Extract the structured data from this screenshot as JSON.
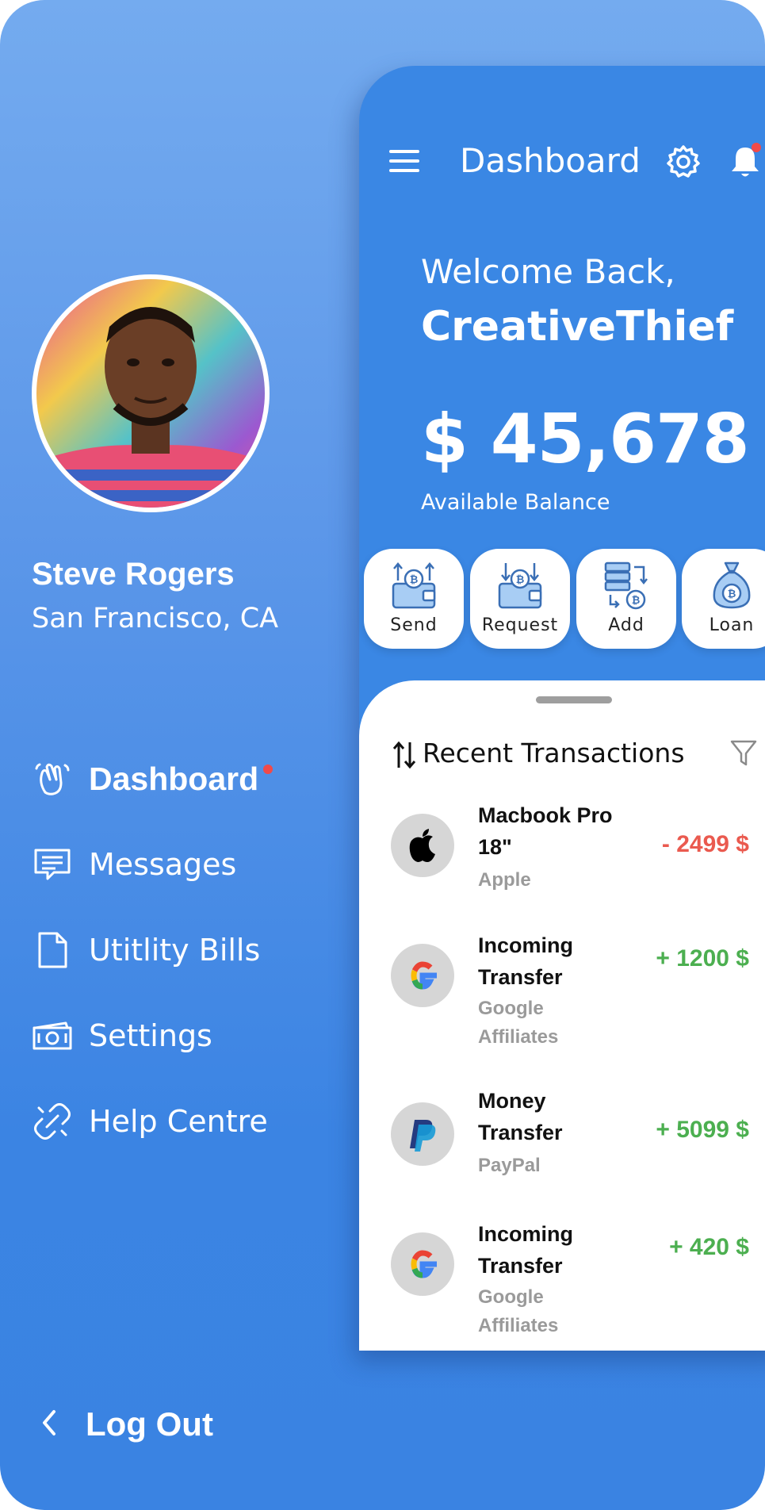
{
  "profile": {
    "name": "Steve Rogers",
    "location": "San Francisco, CA"
  },
  "menu": [
    {
      "label": "Dashboard",
      "icon": "hand-wave-icon",
      "active": true
    },
    {
      "label": "Messages",
      "icon": "message-icon",
      "active": false
    },
    {
      "label": "Utitlity Bills",
      "icon": "document-icon",
      "active": false
    },
    {
      "label": "Settings",
      "icon": "banknote-icon",
      "active": false
    },
    {
      "label": "Help Centre",
      "icon": "link-icon",
      "active": false
    }
  ],
  "logout": {
    "label": "Log Out"
  },
  "header": {
    "title": "Dashboard"
  },
  "welcome": {
    "greeting": "Welcome Back,",
    "username": "CreativeThief"
  },
  "balance": {
    "amount": "$ 45,678",
    "label": "Available Balance"
  },
  "actions": [
    {
      "label": "Send",
      "icon": "wallet-send-icon"
    },
    {
      "label": "Request",
      "icon": "wallet-request-icon"
    },
    {
      "label": "Add",
      "icon": "server-add-icon"
    },
    {
      "label": "Loan",
      "icon": "money-bag-icon"
    }
  ],
  "transactions": {
    "title": "Recent Transactions",
    "items": [
      {
        "name": "Macbook Pro 18\"",
        "merchant": "Apple",
        "amount": "- 2499 $",
        "type": "debit",
        "logo": "apple-icon"
      },
      {
        "name": "Incoming Transfer",
        "merchant": "Google Affiliates",
        "amount": "+ 1200 $",
        "type": "credit",
        "logo": "google-icon"
      },
      {
        "name": "Money Transfer",
        "merchant": "PayPal",
        "amount": "+ 5099 $",
        "type": "credit",
        "logo": "paypal-icon"
      },
      {
        "name": "Incoming Transfer",
        "merchant": "Google Affiliates",
        "amount": "+ 420 $",
        "type": "credit",
        "logo": "google-icon"
      }
    ]
  },
  "colors": {
    "primary": "#3a87e4",
    "debit": "#ea5a4f",
    "credit": "#4caf50",
    "badge": "#f04a4a"
  }
}
